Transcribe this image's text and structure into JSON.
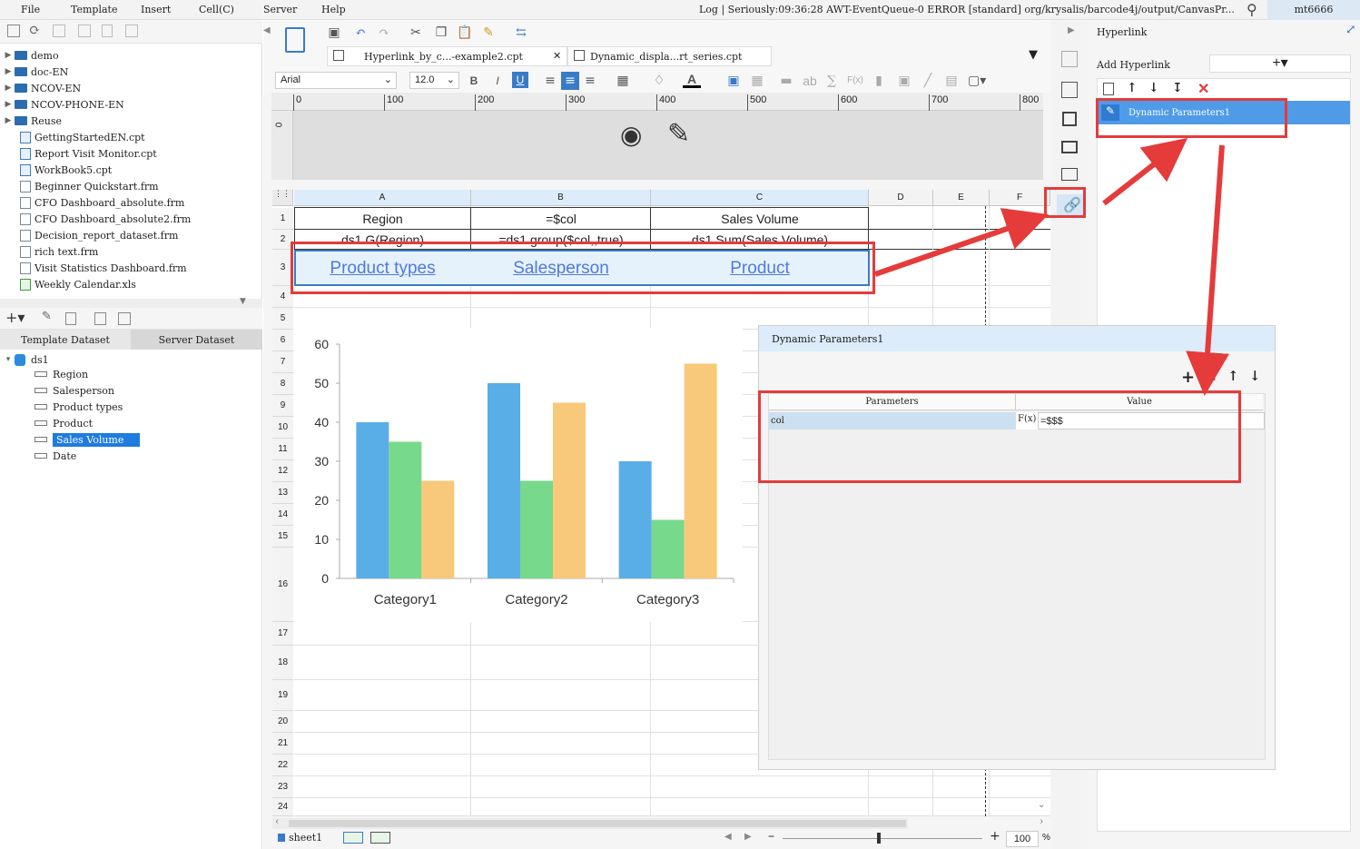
{
  "menu": {
    "items": [
      "File",
      "Template",
      "Insert",
      "Cell(C)",
      "Server",
      "Help"
    ]
  },
  "status": {
    "log_label": "Log",
    "message": "Log | Seriously:09:36:28 AWT-EventQueue-0 ERROR [standard] org/krysalis/barcode4j/output/CanvasPr...",
    "user": "mt6666"
  },
  "filetree": {
    "items": [
      {
        "label": "demo",
        "type": "folder"
      },
      {
        "label": "doc-EN",
        "type": "folder"
      },
      {
        "label": "NCOV-EN",
        "type": "folder"
      },
      {
        "label": "NCOV-PHONE-EN",
        "type": "folder"
      },
      {
        "label": "Reuse",
        "type": "folder"
      },
      {
        "label": "GettingStartedEN.cpt",
        "type": "cpt"
      },
      {
        "label": "Report Visit Monitor.cpt",
        "type": "cpt"
      },
      {
        "label": "WorkBook5.cpt",
        "type": "cpt"
      },
      {
        "label": "Beginner Quickstart.frm",
        "type": "frm"
      },
      {
        "label": "CFO Dashboard_absolute.frm",
        "type": "frm"
      },
      {
        "label": "CFO Dashboard_absolute2.frm",
        "type": "frm"
      },
      {
        "label": "Decision_report_dataset.frm",
        "type": "frm"
      },
      {
        "label": "rich text.frm",
        "type": "frm"
      },
      {
        "label": "Visit Statistics Dashboard.frm",
        "type": "frm"
      },
      {
        "label": "Weekly Calendar.xls",
        "type": "xls"
      }
    ]
  },
  "dataset": {
    "tabs": [
      "Template Dataset",
      "Server Dataset"
    ],
    "ds_name": "ds1",
    "fields": [
      "Region",
      "Salesperson",
      "Product types",
      "Product",
      "Sales Volume",
      "Date"
    ],
    "selected": "Sales Volume"
  },
  "tabs": {
    "tab1": "Hyperlink_by_c...-example2.cpt",
    "tab2": "Dynamic_displa...rt_series.cpt"
  },
  "format": {
    "font": "Arial",
    "size": "12.0"
  },
  "ruler": {
    "ticks": [
      "0",
      "100",
      "200",
      "300",
      "400",
      "500",
      "600",
      "700",
      "800"
    ],
    "vert": "0"
  },
  "sheet": {
    "columns": [
      "A",
      "B",
      "C",
      "D",
      "E",
      "F"
    ],
    "rows": [
      "1",
      "2",
      "3",
      "4",
      "5",
      "6",
      "7",
      "8",
      "9",
      "10",
      "11",
      "12",
      "13",
      "14",
      "15",
      "16",
      "17",
      "18",
      "19",
      "20",
      "21",
      "22",
      "23",
      "24"
    ],
    "cells": {
      "a1": "Region",
      "b1": "=$col",
      "c1": "Sales Volume",
      "a2": "ds1.G(Region)",
      "b2": "=ds1.group($col,,true)",
      "c2": "ds1.Sum(Sales Volume)",
      "a3": "Product types",
      "b3": "Salesperson",
      "c3": "Product"
    },
    "name": "sheet1",
    "zoom": "100",
    "zoom_unit": "%"
  },
  "chart_data": {
    "type": "bar",
    "categories": [
      "Category1",
      "Category2",
      "Category3"
    ],
    "series": [
      {
        "values": [
          40,
          50,
          30
        ],
        "color": "#5aaee8"
      },
      {
        "values": [
          35,
          25,
          15
        ],
        "color": "#77d98b"
      },
      {
        "values": [
          25,
          45,
          55
        ],
        "color": "#f8c97a"
      }
    ],
    "yticks": [
      "0",
      "10",
      "20",
      "30",
      "40",
      "50",
      "60"
    ],
    "ylim": [
      0,
      60
    ],
    "grid": false
  },
  "hyperlink_panel": {
    "title": "Hyperlink",
    "add_label": "Add Hyperlink",
    "items": [
      "Dynamic Parameters1"
    ]
  },
  "dialog": {
    "title": "Dynamic Parameters1",
    "col_params": "Parameters",
    "col_value": "Value",
    "rows": [
      {
        "param": "col",
        "value": "=$$$"
      }
    ],
    "fx": "F(x)"
  }
}
